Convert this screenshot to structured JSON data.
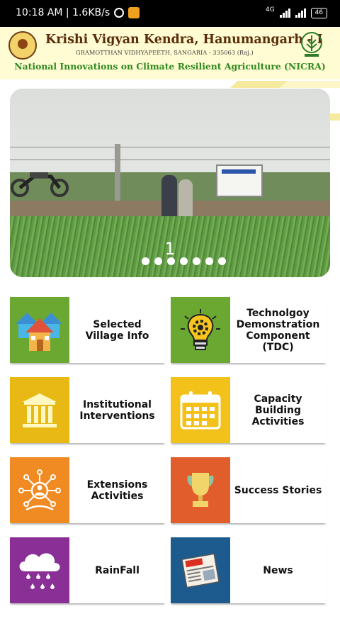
{
  "status_bar": {
    "time": "10:18 AM | 1.6KB/s",
    "network_label": "4G",
    "battery": "46"
  },
  "header": {
    "title": "Krishi Vigyan Kendra, Hanumangarh - I",
    "subtitle": "GRAMOTTHAN VIDHYAPEETH, SANGARIA - 335063 (Raj.)",
    "tagline": "National Innovations on Climate Resilient Agriculture (NICRA)"
  },
  "carousel": {
    "slide_number": "1",
    "dot_count": 7,
    "active_slide": 1
  },
  "menu": [
    {
      "label": "Selected Village Info",
      "icon": "village-houses-icon",
      "color": "#6aa832"
    },
    {
      "label": "Technolgoy Demonstration Component (TDC)",
      "icon": "lightbulb-gear-icon",
      "color": "#6aa832"
    },
    {
      "label": "Institutional Interventions",
      "icon": "institution-building-icon",
      "color": "#e8b914"
    },
    {
      "label": "Capacity Building Activities",
      "icon": "calendar-icon",
      "color": "#f2c11a"
    },
    {
      "label": "Extensions Activities",
      "icon": "network-person-icon",
      "color": "#f08a22"
    },
    {
      "label": "Success Stories",
      "icon": "trophy-icon",
      "color": "#e25d2c"
    },
    {
      "label": "RainFall",
      "icon": "rain-cloud-icon",
      "color": "#8a2f96"
    },
    {
      "label": "News",
      "icon": "newspaper-icon",
      "color": "#1d5b8e"
    }
  ],
  "colors": {
    "header_bg": "#fffbd2",
    "title_brown": "#5a2d0c",
    "tagline_green": "#2f8a1f",
    "stripe_yellow": "#f6eaa0"
  }
}
